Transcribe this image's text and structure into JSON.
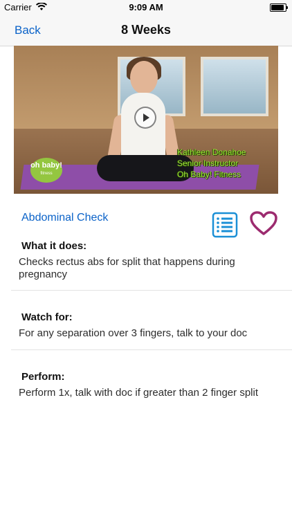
{
  "status_bar": {
    "carrier": "Carrier",
    "time": "9:09 AM",
    "wifi_icon": "wifi-icon",
    "battery_icon": "battery-icon"
  },
  "nav": {
    "back_label": "Back",
    "title": "8 Weeks"
  },
  "video": {
    "logo_text": "oh baby!",
    "logo_sub": "fitness",
    "caption_lines": [
      "Kathleen Donahoe",
      "Senior Instructor",
      "Oh Baby! Fitness"
    ],
    "play_icon": "play-icon"
  },
  "exercise": {
    "name": "Abdominal Check",
    "notes_icon": "notes-list-icon",
    "favorite_icon": "heart-icon",
    "accent_color": "#0a62c8",
    "heart_color": "#9c2b6f"
  },
  "sections": [
    {
      "heading": "What it does:",
      "body": "Checks rectus abs for split that happens during pregnancy"
    },
    {
      "heading": "Watch for:",
      "body": "For any separation over 3 fingers, talk to your doc"
    },
    {
      "heading": "Perform:",
      "body": "Perform 1x, talk with doc if greater than 2 finger split"
    }
  ]
}
